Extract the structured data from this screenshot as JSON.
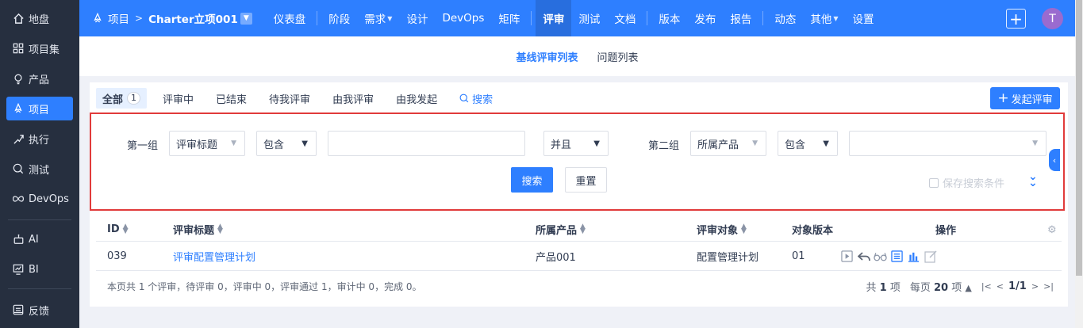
{
  "sidebar": {
    "items": [
      {
        "label": "地盘",
        "icon": "home-icon"
      },
      {
        "label": "项目集",
        "icon": "grid-icon"
      },
      {
        "label": "产品",
        "icon": "lightbulb-icon"
      },
      {
        "label": "项目",
        "icon": "rocket-icon",
        "active": true
      },
      {
        "label": "执行",
        "icon": "run-icon"
      },
      {
        "label": "测试",
        "icon": "test-icon"
      },
      {
        "label": "DevOps",
        "icon": "infinity-icon"
      },
      {
        "label": "AI",
        "icon": "robot-icon"
      },
      {
        "label": "BI",
        "icon": "chart-icon"
      },
      {
        "label": "反馈",
        "icon": "feedback-icon"
      }
    ]
  },
  "topbar": {
    "breadcrumb_root": "项目",
    "project_name": "Charter立项001",
    "nav": [
      "仪表盘",
      "阶段",
      "需求",
      "设计",
      "DevOps",
      "矩阵",
      "评审",
      "测试",
      "文档",
      "版本",
      "发布",
      "报告",
      "动态",
      "其他",
      "设置"
    ],
    "active_nav": "评审",
    "avatar_letter": "T"
  },
  "subnav": {
    "items": [
      "基线评审列表",
      "问题列表"
    ],
    "active": "基线评审列表"
  },
  "filters": {
    "tabs": [
      {
        "label": "全部",
        "count": "1"
      },
      {
        "label": "评审中"
      },
      {
        "label": "已结束"
      },
      {
        "label": "待我评审"
      },
      {
        "label": "由我评审"
      },
      {
        "label": "由我发起"
      }
    ],
    "search_label": "搜索",
    "create_label": "发起评审"
  },
  "search_form": {
    "group1_label": "第一组",
    "group1_field": "评审标题",
    "group1_operator": "包含",
    "group1_value": "",
    "logic": "并且",
    "group2_label": "第二组",
    "group2_field": "所属产品",
    "group2_operator": "包含",
    "group2_value": "",
    "search_button": "搜索",
    "reset_button": "重置",
    "save_condition": "保存搜索条件"
  },
  "table": {
    "columns": [
      "ID",
      "评审标题",
      "所属产品",
      "评审对象",
      "对象版本",
      "操作"
    ],
    "rows": [
      {
        "id": "039",
        "title": "评审配置管理计划",
        "product": "产品001",
        "object": "配置管理计划",
        "version": "01"
      }
    ],
    "summary": "本页共 1 个评审，待评审 0，评审中 0，评审通过 1，审计中 0，完成 0。",
    "pager": {
      "total_prefix": "共",
      "total": "1",
      "total_suffix": "项",
      "per_page_prefix": "每页",
      "per_page": "20",
      "per_page_suffix": "项",
      "page": "1/1"
    }
  },
  "colors": {
    "primary": "#2e7fff",
    "sidebar_bg": "#262f3f",
    "highlight_border": "#e13b3b",
    "avatar": "#9a6bcf"
  }
}
